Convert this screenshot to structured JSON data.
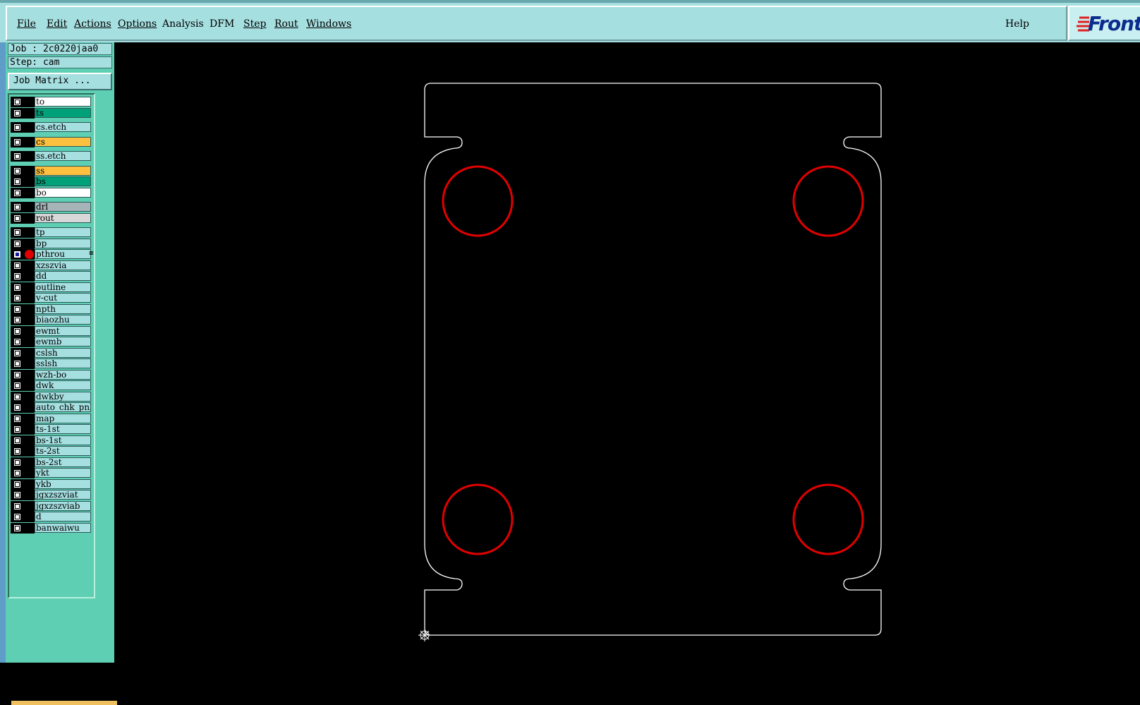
{
  "menu": {
    "items": [
      {
        "label": "File"
      },
      {
        "label": "Edit"
      },
      {
        "label": "Actions"
      },
      {
        "label": "Options"
      },
      {
        "label": "Analysis"
      },
      {
        "label": "DFM"
      },
      {
        "label": "Step"
      },
      {
        "label": "Rout"
      },
      {
        "label": "Windows"
      }
    ],
    "help": "Help",
    "logo_text": "Front"
  },
  "left_panel": {
    "job": "Job : 2c0220jaa0",
    "step": "Step: cam",
    "job_matrix_button": "Job Matrix ...",
    "layers": [
      {
        "name": "to",
        "color": "#ffffff"
      },
      {
        "name": "ts",
        "color": "#00a078"
      },
      {
        "name": "cs.etch",
        "color": "#a6dfe0"
      },
      {
        "name": "cs",
        "color": "#ffc040"
      },
      {
        "name": "ss.etch",
        "color": "#a6dfe0"
      },
      {
        "name": "ss",
        "color": "#ffc040"
      },
      {
        "name": "bs",
        "color": "#00a078"
      },
      {
        "name": "bo",
        "color": "#ffffff"
      },
      {
        "name": "drl",
        "color": "#a6b4b8"
      },
      {
        "name": "rout",
        "color": "#d8d8d8"
      },
      {
        "name": "tp",
        "color": "#a6dfe0"
      },
      {
        "name": "bp",
        "color": "#a6dfe0"
      },
      {
        "name": "pthrou",
        "color": "#a6dfe0",
        "active": true
      },
      {
        "name": "xzszvia",
        "color": "#a6dfe0"
      },
      {
        "name": "dd",
        "color": "#a6dfe0"
      },
      {
        "name": "outline",
        "color": "#a6dfe0"
      },
      {
        "name": "v-cut",
        "color": "#a6dfe0"
      },
      {
        "name": "npth",
        "color": "#a6dfe0"
      },
      {
        "name": "biaozhu",
        "color": "#a6dfe0"
      },
      {
        "name": "ewmt",
        "color": "#a6dfe0"
      },
      {
        "name": "ewmb",
        "color": "#a6dfe0"
      },
      {
        "name": "cslsh",
        "color": "#a6dfe0"
      },
      {
        "name": "sslsh",
        "color": "#a6dfe0"
      },
      {
        "name": "wzh-bo",
        "color": "#a6dfe0"
      },
      {
        "name": "dwk",
        "color": "#a6dfe0"
      },
      {
        "name": "dwkby",
        "color": "#a6dfe0"
      },
      {
        "name": "auto_chk_pnl",
        "color": "#a6dfe0"
      },
      {
        "name": "map",
        "color": "#a6dfe0"
      },
      {
        "name": "ts-1st",
        "color": "#a6dfe0"
      },
      {
        "name": "bs-1st",
        "color": "#a6dfe0"
      },
      {
        "name": "ts-2st",
        "color": "#a6dfe0"
      },
      {
        "name": "bs-2st",
        "color": "#a6dfe0"
      },
      {
        "name": "ykt",
        "color": "#a6dfe0"
      },
      {
        "name": "ykb",
        "color": "#a6dfe0"
      },
      {
        "name": "jgxzszviat",
        "color": "#a6dfe0"
      },
      {
        "name": "jgxzszviab",
        "color": "#a6dfe0"
      },
      {
        "name": "d",
        "color": "#a6dfe0"
      },
      {
        "name": "banwaiwu",
        "color": "#a6dfe0"
      }
    ]
  },
  "colors": {
    "menu_bg": "#a6dfe0",
    "panel_bg": "#5ecfb2",
    "canvas_bg": "#000000",
    "outline_color": "#ffffff",
    "hole_color": "#e00000"
  }
}
